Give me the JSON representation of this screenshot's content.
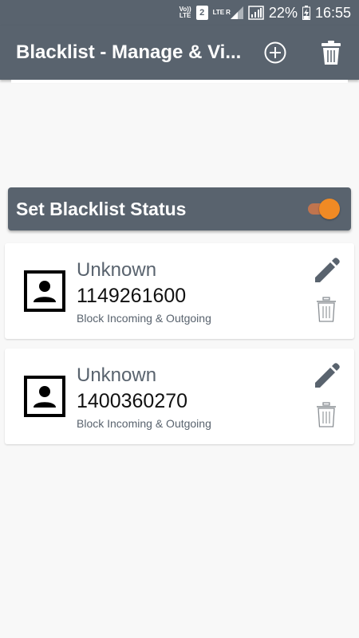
{
  "status_bar": {
    "volte_top": "Vo))",
    "volte_bottom": "LTE",
    "sim_number": "2",
    "lte_label": "LTE",
    "roaming": "R",
    "battery": "22%",
    "time": "16:55"
  },
  "app_bar": {
    "title": "Blacklist - Manage & Vi...",
    "add_icon": "add-circle-icon",
    "delete_icon": "trash-icon"
  },
  "status_toggle": {
    "label": "Set Blacklist Status",
    "enabled": true
  },
  "entries": [
    {
      "name": "Unknown",
      "number": "1149261600",
      "mode": "Block Incoming & Outgoing"
    },
    {
      "name": "Unknown",
      "number": "1400360270",
      "mode": "Block Incoming & Outgoing"
    }
  ],
  "colors": {
    "primary": "#59636e",
    "accent": "#f08a24",
    "background": "#f8f8f8"
  }
}
